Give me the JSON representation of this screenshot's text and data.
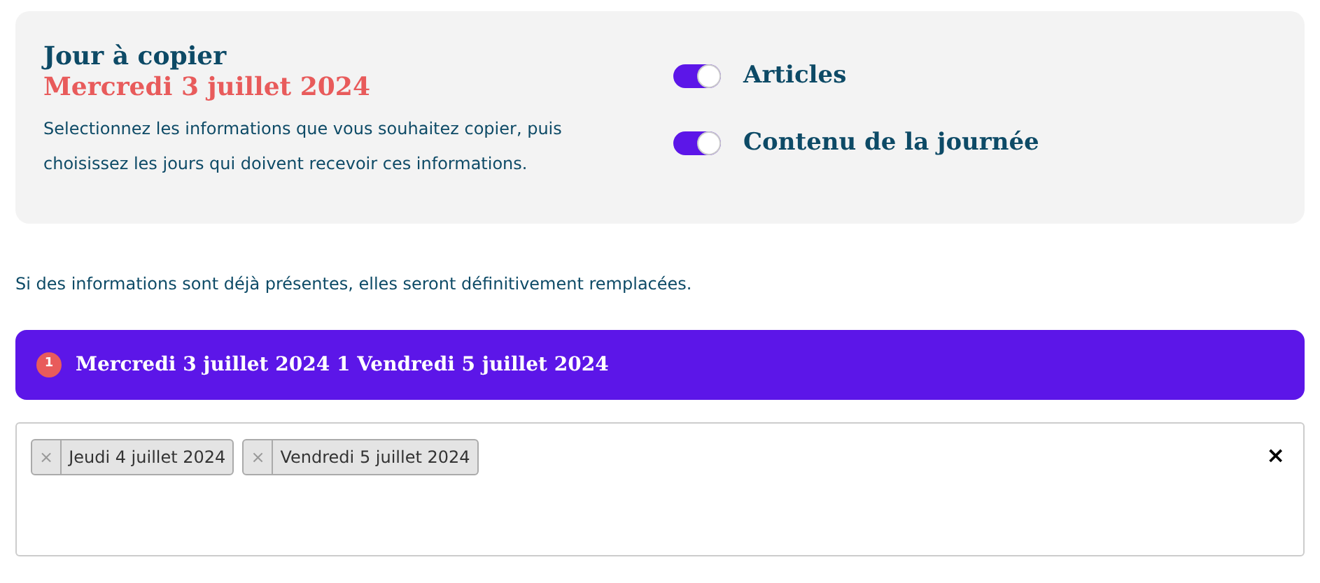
{
  "copy_card": {
    "title": "Jour à copier",
    "date": "Mercredi 3 juillet 2024",
    "description": "Selectionnez les informations que vous souhaitez copier, puis choisissez les jours qui doivent recevoir ces informations.",
    "options": [
      {
        "label": "Articles",
        "on": true
      },
      {
        "label": "Contenu de la journée",
        "on": true
      }
    ]
  },
  "warning": "Si des informations sont déjà présentes, elles seront définitivement remplacées.",
  "range_bar": {
    "badge": "1",
    "text": "Mercredi 3 juillet 2024 1 Vendredi 5 juillet 2024"
  },
  "day_select": {
    "clear": "×",
    "tags": [
      {
        "remove": "×",
        "label": "Jeudi 4 juillet 2024"
      },
      {
        "remove": "×",
        "label": "Vendredi 5 juillet 2024"
      }
    ]
  }
}
